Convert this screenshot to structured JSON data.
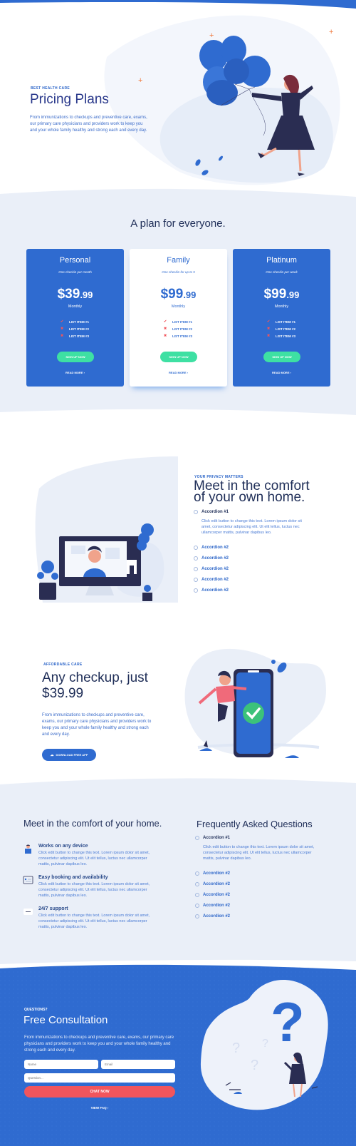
{
  "colors": {
    "primary": "#2f6bd0",
    "accent_green": "#3ee0a3",
    "accent_red": "#f1555c",
    "band": "#eaeff8",
    "heading": "#1e2d57"
  },
  "hero": {
    "eyebrow": "BEST HEALTH CARE",
    "title": "Pricing Plans",
    "body": "From immunizations to checkups and  preventive care, exams, our primary care physicians and providers work to keep you and your whole family healthy and strong each and every day."
  },
  "pricing": {
    "title": "A plan for everyone.",
    "plans": [
      {
        "name": "Personal",
        "subtitle": "One checkin per month",
        "currency": "$",
        "price": "39",
        "cents": ".99",
        "period": "Monthly",
        "items": [
          "LIST ITEM #1",
          "LIST ITEM #2",
          "LIST ITEM #3"
        ],
        "cta": "SIGN UP NOW",
        "more": "READ MORE ›"
      },
      {
        "name": "Family",
        "subtitle": "One checkin for up to 5",
        "currency": "$",
        "price": "99",
        "cents": ".99",
        "period": "Monthly",
        "items": [
          "LIST ITEM #1",
          "LIST ITEM #2",
          "LIST ITEM #3"
        ],
        "cta": "SIGN UP NOW",
        "more": "READ MORE ›"
      },
      {
        "name": "Platinum",
        "subtitle": "One checkin per week",
        "currency": "$",
        "price": "99",
        "cents": ".99",
        "period": "Monthly",
        "items": [
          "LIST ITEM #1",
          "LIST ITEM #2",
          "LIST ITEM #3"
        ],
        "cta": "SIGN UP NOW",
        "more": "READ MORE ›"
      }
    ],
    "marks": [
      "✔",
      "✖",
      "✖"
    ]
  },
  "privacy": {
    "eyebrow": "YOUR PRIVACY MATTERS",
    "title_line1": "Meet in the comfort",
    "title_line2": "of your own home.",
    "accordion": [
      {
        "label": "Accordion #1",
        "body": "Click edit button to change this text. Lorem ipsum dolor sit amet, consectetur adipiscing elit. Ut elit tellus, luctus nec ullamcorper mattis, pulvinar dapibus leo."
      },
      {
        "label": "Accordion #2"
      },
      {
        "label": "Accordion #2"
      },
      {
        "label": "Accordion #2"
      },
      {
        "label": "Accordion #2"
      },
      {
        "label": "Accordion #2"
      }
    ]
  },
  "checkup": {
    "eyebrow": "AFFORDABLE CARE",
    "title_line1": "Any checkup, just",
    "title_line2": "$39.99",
    "body": "From immunizations to checkups and  preventive care, exams, our primary care physicians and providers work to keep you and your whole family healthy and strong each and every day.",
    "cta": "DOWNLOAD FREE APP"
  },
  "features": {
    "title": "Meet in the comfort of your home.",
    "items": [
      {
        "title": "Works on any device",
        "body": "Click edit button to change this text. Lorem ipsum dolor sit amet, consectetur adipiscing elit. Ut elit tellus, luctus nec ullamcorper mattis, pulvinar dapibus leo."
      },
      {
        "title": "Easy booking and availability",
        "body": "Click edit button to change this text. Lorem ipsum dolor sit amet, consectetur adipiscing elit. Ut elit tellus, luctus nec ullamcorper mattis, pulvinar dapibus leo."
      },
      {
        "title": "24/7 support",
        "body": "Click edit button to change this text. Lorem ipsum dolor sit amet, consectetur adipiscing elit. Ut elit tellus, luctus nec ullamcorper mattis, pulvinar dapibus leo."
      }
    ]
  },
  "faq": {
    "title": "Frequently Asked Questions",
    "accordion": [
      {
        "label": "Accordion #1",
        "body": "Click edit button to change this text. Lorem ipsum dolor sit amet, consectetur adipiscing elit. Ut elit tellus, luctus nec ullamcorper mattis, pulvinar dapibus leo."
      },
      {
        "label": "Accordion #2"
      },
      {
        "label": "Accordion #2"
      },
      {
        "label": "Accordion #2"
      },
      {
        "label": "Accordion #2"
      },
      {
        "label": "Accordion #2"
      }
    ]
  },
  "consult": {
    "eyebrow": "QUESTIONS?",
    "title": "Free Consultation",
    "body": "From immunizations to checkups and  preventive care,  exams, our primary care physicians and providers work to keep you and your whole family healthy and strong each and every day.",
    "name_placeholder": "Name",
    "email_placeholder": "Email",
    "question_placeholder": "Question...",
    "cta": "CHAT NOW",
    "faq_link": "VIEW FAQ ›"
  }
}
